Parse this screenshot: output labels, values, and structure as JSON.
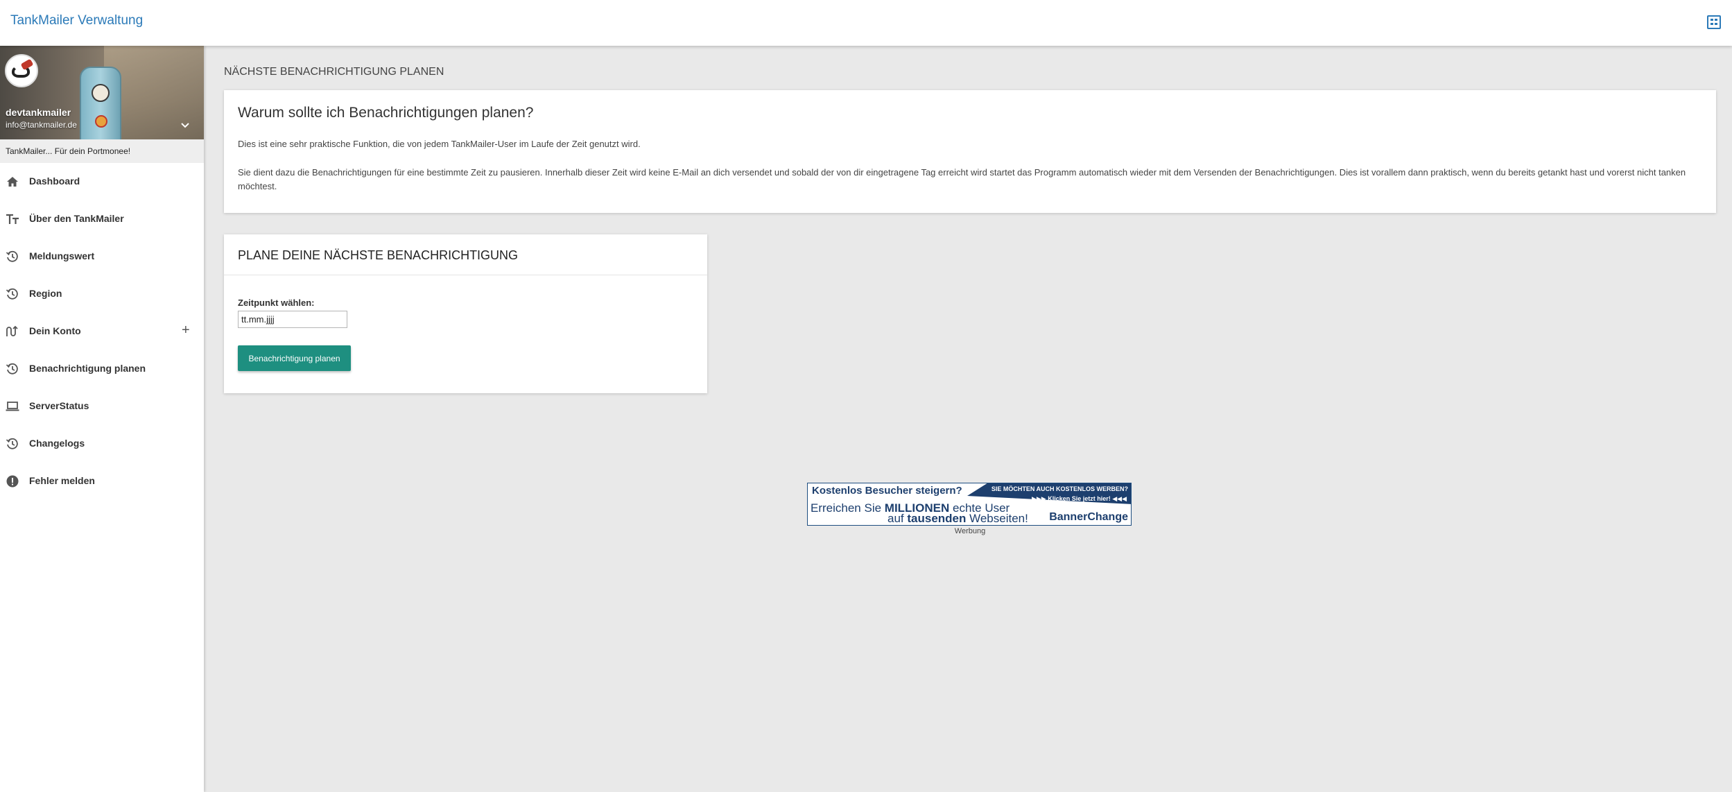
{
  "header": {
    "app_title": "TankMailer Verwaltung",
    "right_icon": "grid-icon"
  },
  "profile": {
    "username": "devtankmailer",
    "email": "info@tankmailer.de",
    "tagline": "TankMailer... Für dein Portmonee!"
  },
  "sidebar": {
    "items": [
      {
        "label": "Dashboard",
        "icon": "home-icon"
      },
      {
        "label": "Über den TankMailer",
        "icon": "text-size-icon"
      },
      {
        "label": "Meldungswert",
        "icon": "history-icon"
      },
      {
        "label": "Region",
        "icon": "history-icon"
      },
      {
        "label": "Dein Konto",
        "icon": "route-icon",
        "expand": "+"
      },
      {
        "label": "Benachrichtigung planen",
        "icon": "history-icon"
      },
      {
        "label": "ServerStatus",
        "icon": "laptop-icon"
      },
      {
        "label": "Changelogs",
        "icon": "history-icon"
      },
      {
        "label": "Fehler melden",
        "icon": "alert-icon"
      }
    ]
  },
  "main": {
    "page_heading": "NÄCHSTE BENACHRICHTIGUNG PLANEN",
    "info_card": {
      "title": "Warum sollte ich Benachrichtigungen planen?",
      "paragraph1": "Dies ist eine sehr praktische Funktion, die von jedem TankMailer-User im Laufe der Zeit genutzt wird.",
      "paragraph2": "Sie dient dazu die Benachrichtigungen für eine bestimmte Zeit zu pausieren. Innerhalb dieser Zeit wird keine E-Mail an dich versendet und sobald der von dir eingetragene Tag erreicht wird startet das Programm automatisch wieder mit dem Versenden der Benachrichtigungen. Dies ist vorallem dann praktisch, wenn du bereits getankt hast und vorerst nicht tanken möchtest."
    },
    "form_card": {
      "title": "PLANE DEINE NÄCHSTE BENACHRICHTIGUNG",
      "date_label": "Zeitpunkt wählen:",
      "date_placeholder": "tt.mm.jjjj",
      "submit_label": "Benachrichtigung planen",
      "accent_color": "#1e8f80"
    }
  },
  "ad": {
    "line1": "Kostenlos Besucher steigern?",
    "right_top": "SIE MÖCHTEN AUCH KOSTENLOS WERBEN?",
    "right_sub": "▶▶▶ Klicken Sie jetzt hier! ◀◀◀",
    "line2_pre": "Erreichen Sie ",
    "line2_bold": "MILLIONEN",
    "line2_post": " echte User",
    "line3_pre": "auf ",
    "line3_bold": "tausenden",
    "line3_post": " Webseiten!",
    "brand": "BannerChange",
    "caption": "Werbung"
  }
}
